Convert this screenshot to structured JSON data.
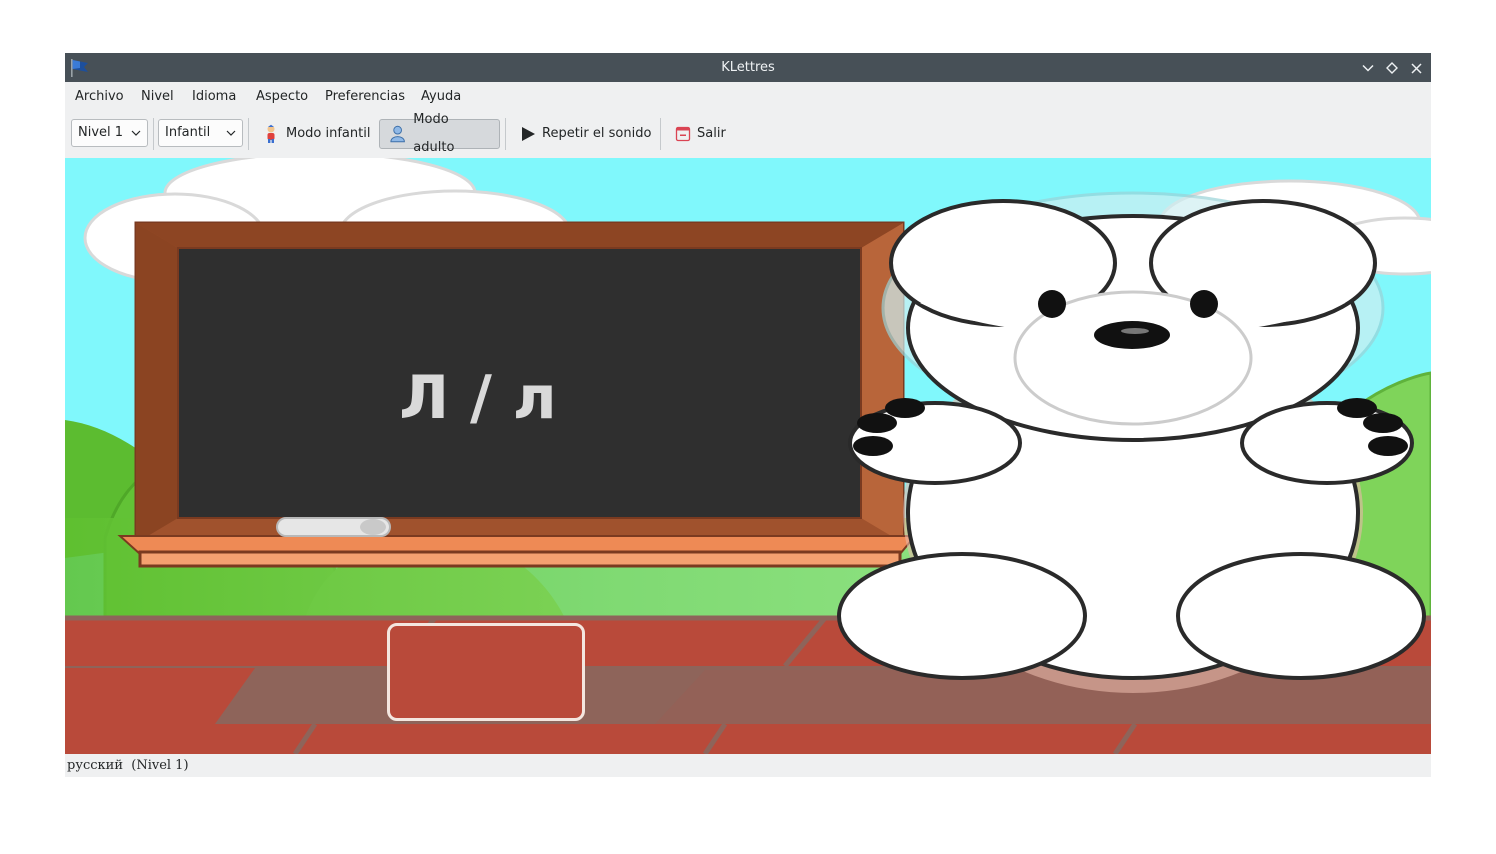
{
  "window": {
    "title": "KLettres"
  },
  "menubar": {
    "items": [
      "Archivo",
      "Nivel",
      "Idioma",
      "Aspecto",
      "Preferencias",
      "Ayuda"
    ]
  },
  "toolbar": {
    "level_combo": "Nivel 1",
    "mode_combo": "Infantil",
    "kid_mode": "Modo infantil",
    "grown_mode": "Modo adulto",
    "repeat_sound": "Repetir el sonido",
    "quit": "Salir"
  },
  "board": {
    "letter": "Л / л"
  },
  "statusbar": {
    "text": "русский  (Nivel 1)"
  },
  "answer_input": {
    "value": ""
  },
  "colors": {
    "titlebar": "#475057",
    "sky": "#80f8fc",
    "chalkboard": "#2f2f2f",
    "frame": "#a0522d",
    "bricks": "#b94a3a"
  }
}
